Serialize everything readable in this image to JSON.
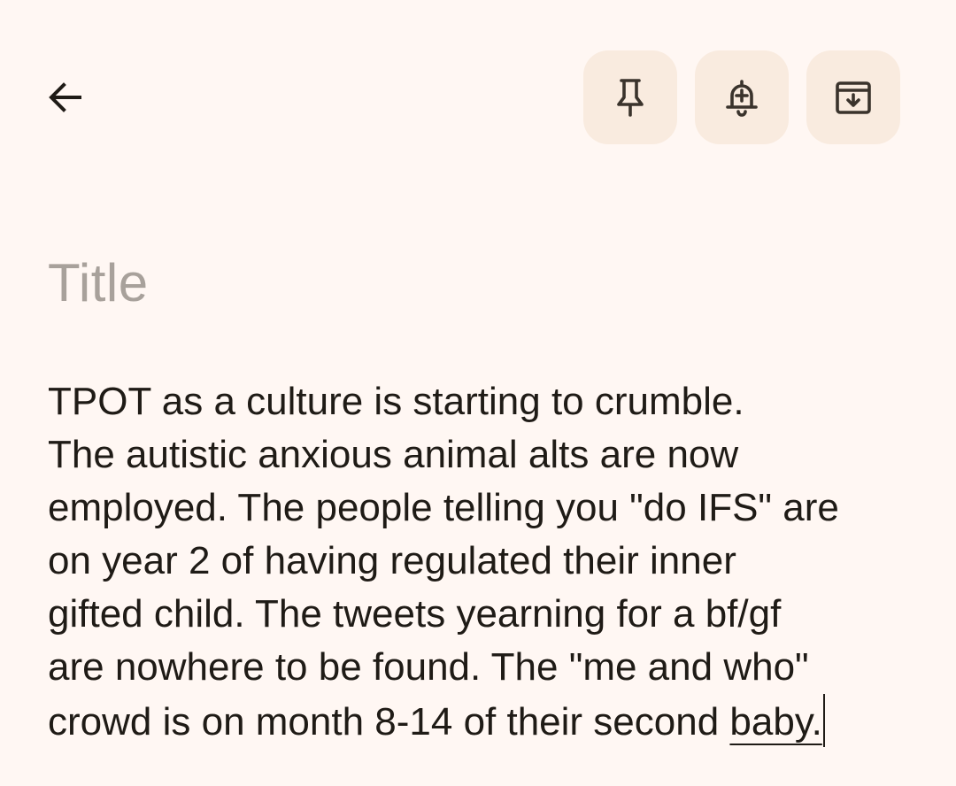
{
  "toolbar": {
    "back_icon": "arrow-back-icon",
    "pin_icon": "pin-icon",
    "reminder_icon": "bell-plus-icon",
    "archive_icon": "archive-icon",
    "button_color": "#f9ebdf"
  },
  "note": {
    "title_placeholder": "Title",
    "body_lines": [
      "TPOT as a culture is starting to crumble.",
      "The autistic anxious animal alts are now",
      "employed. The people telling you \"do IFS\" are",
      "on year 2 of having regulated their inner",
      "gifted child. The tweets yearning for a bf/gf",
      "are nowhere to be found. The \"me and who\""
    ],
    "last_line_prefix": "crowd is on month 8-14 of their second ",
    "last_line_underlined": "baby."
  },
  "colors": {
    "background": "#fff7f3",
    "text": "#1f1b16",
    "placeholder": "#a8a19b"
  }
}
